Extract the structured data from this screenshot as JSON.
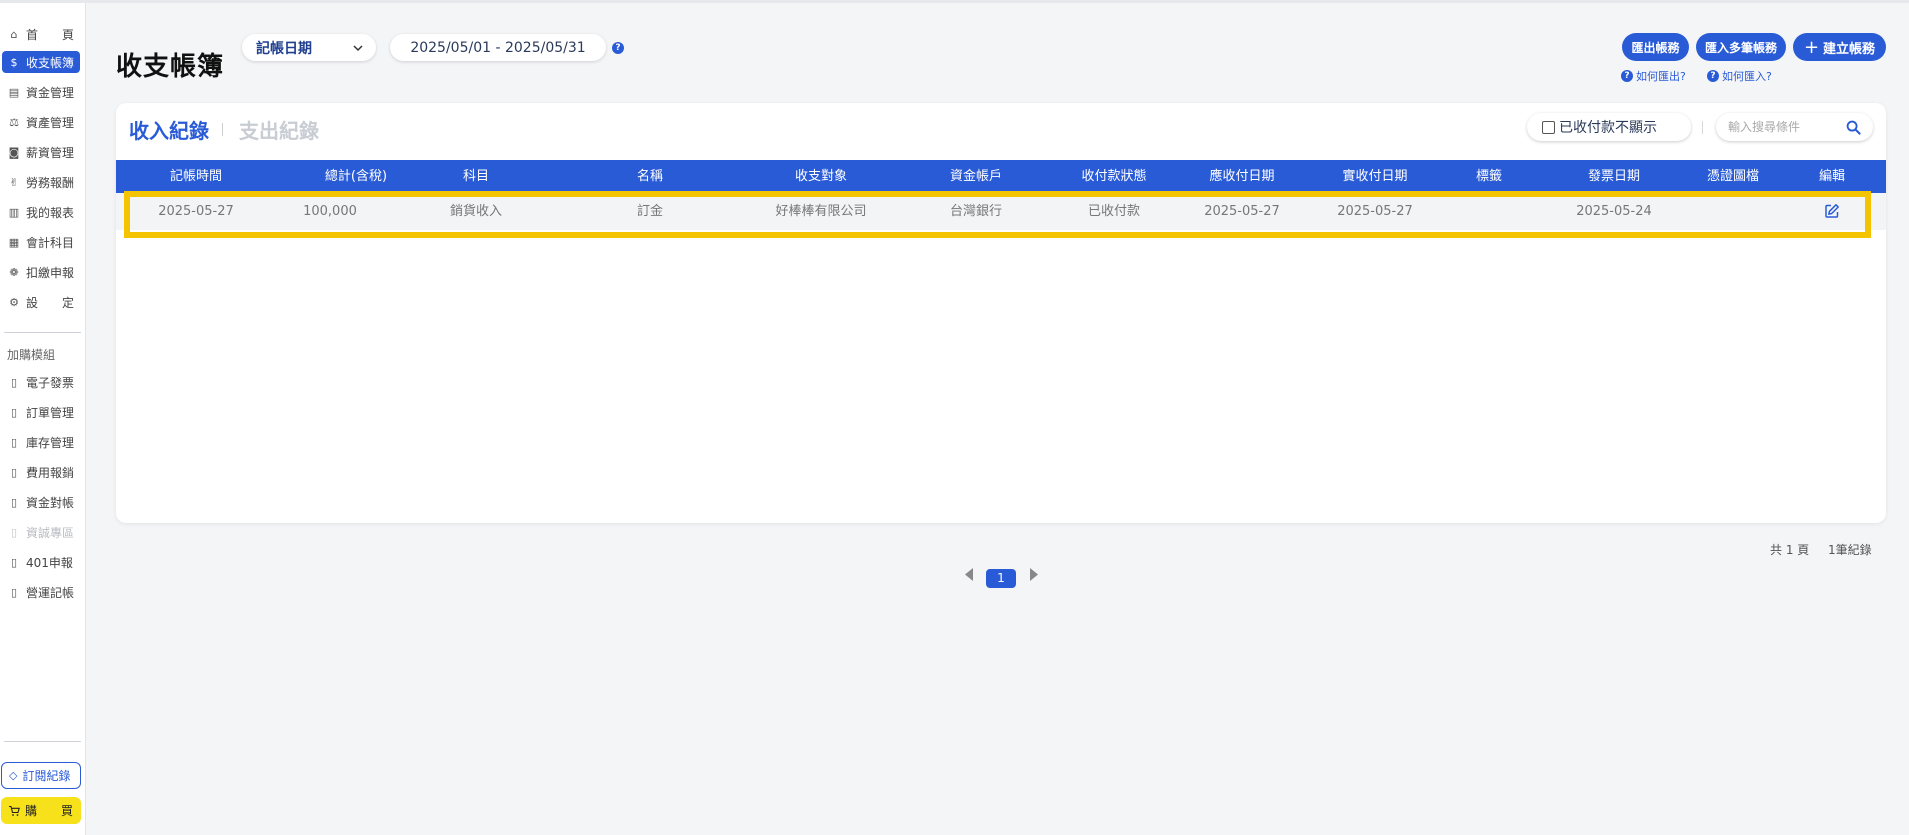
{
  "sidebar": {
    "items": [
      {
        "label": "首　　頁",
        "icon": "home-icon",
        "glyph": "⌂"
      },
      {
        "label": "收支帳簿",
        "icon": "dollar-circle-icon",
        "glyph": "$"
      },
      {
        "label": "資金管理",
        "icon": "cash-icon",
        "glyph": "▤"
      },
      {
        "label": "資產管理",
        "icon": "scale-icon",
        "glyph": "⚖"
      },
      {
        "label": "薪資管理",
        "icon": "salary-icon",
        "glyph": "◙"
      },
      {
        "label": "勞務報酬",
        "icon": "handshake-icon",
        "glyph": "✌"
      },
      {
        "label": "我的報表",
        "icon": "bar-chart-icon",
        "glyph": "▥"
      },
      {
        "label": "會計科目",
        "icon": "ledger-icon",
        "glyph": "▦"
      },
      {
        "label": "扣繳申報",
        "icon": "declare-icon",
        "glyph": "❁"
      },
      {
        "label": "設　　定",
        "icon": "sliders-icon",
        "glyph": "⚙"
      }
    ],
    "addon_label": "加購模組",
    "addons": [
      {
        "label": "電子發票",
        "icon": "module-icon",
        "glyph": "▯"
      },
      {
        "label": "訂單管理",
        "icon": "module-icon",
        "glyph": "▯"
      },
      {
        "label": "庫存管理",
        "icon": "module-icon",
        "glyph": "▯"
      },
      {
        "label": "費用報銷",
        "icon": "module-icon",
        "glyph": "▯"
      },
      {
        "label": "資金對帳",
        "icon": "module-icon",
        "glyph": "▯"
      },
      {
        "label": "資誠專區",
        "icon": "module-icon",
        "glyph": "▯"
      },
      {
        "label": "401申報",
        "icon": "module-icon",
        "glyph": "▯"
      },
      {
        "label": "營運記帳",
        "icon": "module-icon",
        "glyph": "▯"
      }
    ],
    "subscription_label": "訂閱紀錄",
    "buy_label": "購　　買"
  },
  "header": {
    "title": "收支帳簿",
    "date_type": "記帳日期",
    "date_range": "2025/05/01 - 2025/05/31",
    "export_label": "匯出帳務",
    "import_label": "匯入多筆帳務",
    "create_label": "建立帳務",
    "how_export": "如何匯出?",
    "how_import": "如何匯入?"
  },
  "tabs": {
    "income": "收入紀錄",
    "expense": "支出紀錄"
  },
  "filter": {
    "hide_paid_label": "已收付款不顯示",
    "search_placeholder": "輸入搜尋條件"
  },
  "table": {
    "columns": [
      "記帳時間",
      "總計(含稅)",
      "科目",
      "名稱",
      "收支對象",
      "資金帳戶",
      "收付款狀態",
      "應收付日期",
      "實收付日期",
      "標籤",
      "發票日期",
      "憑證圖檔",
      "編輯"
    ],
    "rows": [
      {
        "cells": [
          "2025-05-27",
          "100,000",
          "銷貨收入",
          "訂金",
          "好棒棒有限公司",
          "台灣銀行",
          "已收付款",
          "2025-05-27",
          "2025-05-27",
          "",
          "2025-05-24",
          ""
        ]
      }
    ]
  },
  "pagination": {
    "total_pages": "共 1 頁",
    "total_records": "1筆紀錄",
    "current_page": "1"
  },
  "colors": {
    "primary": "#2a5bd7",
    "highlight": "#f5c400",
    "buy_button": "#f7e11a"
  }
}
